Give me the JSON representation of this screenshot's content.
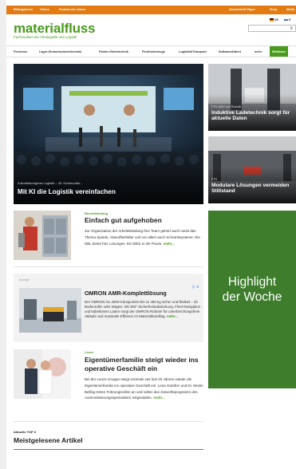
{
  "topbar": {
    "left_links": [
      "Bildergalerien",
      "Videos",
      "Produkt des Jahres"
    ],
    "right_links": [
      "Newsletter/E-Paper",
      "Shop",
      "Media"
    ]
  },
  "brand": {
    "logo": "materialfluss",
    "tagline": "Fachmedium der Intralogistik und Logistik",
    "accent": "#4a9a1f"
  },
  "language": {
    "de": "DE",
    "en": "E"
  },
  "search": {
    "placeholder": ""
  },
  "nav": {
    "items": [
      "Personen",
      "Lager-/Kommissioniertechnik",
      "Förder-/Hebetechnik",
      "Flurförderzeuge",
      "Logistik&Transport",
      "Software&Ident",
      "mehr"
    ],
    "active": "Webinare"
  },
  "hero": {
    "caption": "Zukunftskongress Logistik – 43. Dortmunder...",
    "title": "Mit KI die Logistik vereinfachen"
  },
  "side_cards": [
    {
      "kicker": "FTS, AGV und Robotik",
      "title": "Induktive Ladetechnik sorgt für aktuelle Daten"
    },
    {
      "kicker": "FTS",
      "title": "Modulare Lösungen vermeiden Stillstand"
    }
  ],
  "highlight": {
    "title": "Highlight der Woche",
    "color": "#3d7d2c"
  },
  "articles": [
    {
      "kicker": "Berufskleidung",
      "title": "Einfach gut aufgehoben",
      "text": "Zur Organisation der Arbeitskleidung fürs Team gehört auch meist das Thema Spinde, Abwurfbehälter und vor allem auch Schranksysteme. Die DBL bietet hier Lösungen. Ein Blick in die Praxis.",
      "more": "mehr..."
    },
    {
      "kicker": "Lenze",
      "title": "Eigentümerfamilie steigt wieder ins operative Geschäft ein",
      "text": "Bei der Lenze Gruppe steigt erstmals seit fast 20 Jahren wieder die Eigentümerfamilie ins operative Geschäft ein. Lena Günther und Dr. Moritz Belling treten Führungsrollen an und sollen das Zukunftsprogramm des Automatisierungsspezialisten mitgestalten.",
      "more": "mehr..."
    }
  ],
  "ad": {
    "label": "Anzeige",
    "choice": "▷ x",
    "title": "OMRON AMR-Komplettlösung",
    "text": "Der OMRON OL-450S transportiert bis zu 450 kg sicher und flexibel – ob Bodenroller oder Wagen. Mit 360°-Sicherheitsabdeckung, Fleet-Navigation und kabellosem Laden sorgt der OMRON Roboter für unterbrechungsfreie Abläufe und maximale Effizienz im Materialhandling.",
    "more": "mehr..."
  },
  "top3": {
    "kicker": "Aktuelle TOP 3",
    "title": "Meistgelesene Artikel"
  }
}
